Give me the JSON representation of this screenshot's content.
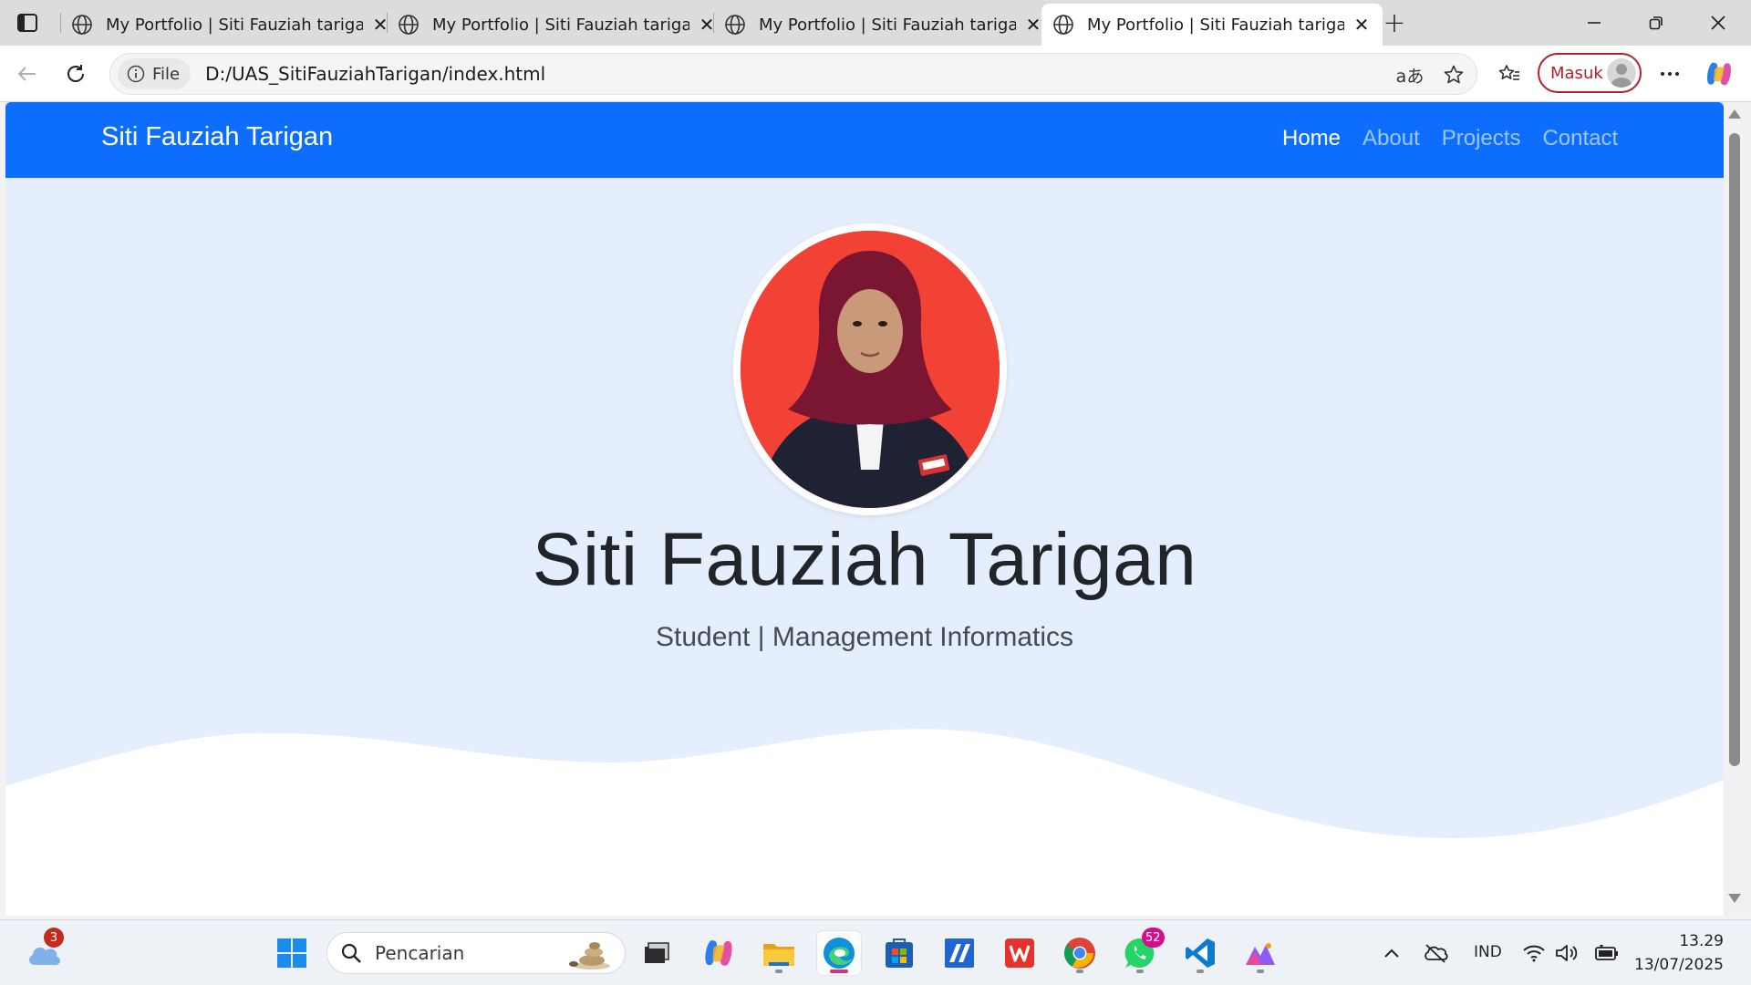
{
  "browser": {
    "tabs": [
      {
        "title": "My Portfolio | Siti Fauziah tarigan",
        "active": false
      },
      {
        "title": "My Portfolio | Siti Fauziah tarigan",
        "active": false
      },
      {
        "title": "My Portfolio | Siti Fauziah tarigan",
        "active": false
      },
      {
        "title": "My Portfolio | Siti Fauziah tarigan",
        "active": true
      }
    ],
    "site_info_label": "File",
    "url": "D:/UAS_SitiFauziahTarigan/index.html",
    "profile_label": "Masuk"
  },
  "page": {
    "navbar": {
      "brand": "Siti Fauziah Tarigan",
      "links": [
        {
          "label": "Home",
          "active": true
        },
        {
          "label": "About",
          "active": false
        },
        {
          "label": "Projects",
          "active": false
        },
        {
          "label": "Contact",
          "active": false
        }
      ]
    },
    "hero": {
      "name": "Siti Fauziah Tarigan",
      "subtitle": "Student | Management Informatics"
    }
  },
  "taskbar": {
    "weather_badge": "3",
    "search_placeholder": "Pencarian",
    "whatsapp_badge": "52",
    "language": "IND",
    "time": "13.29",
    "date": "13/07/2025"
  },
  "colors": {
    "navbar": "#0d6efd",
    "hero_background": "#e5eefc",
    "avatar_background": "#f24236",
    "profile_accent": "#b2212c"
  }
}
